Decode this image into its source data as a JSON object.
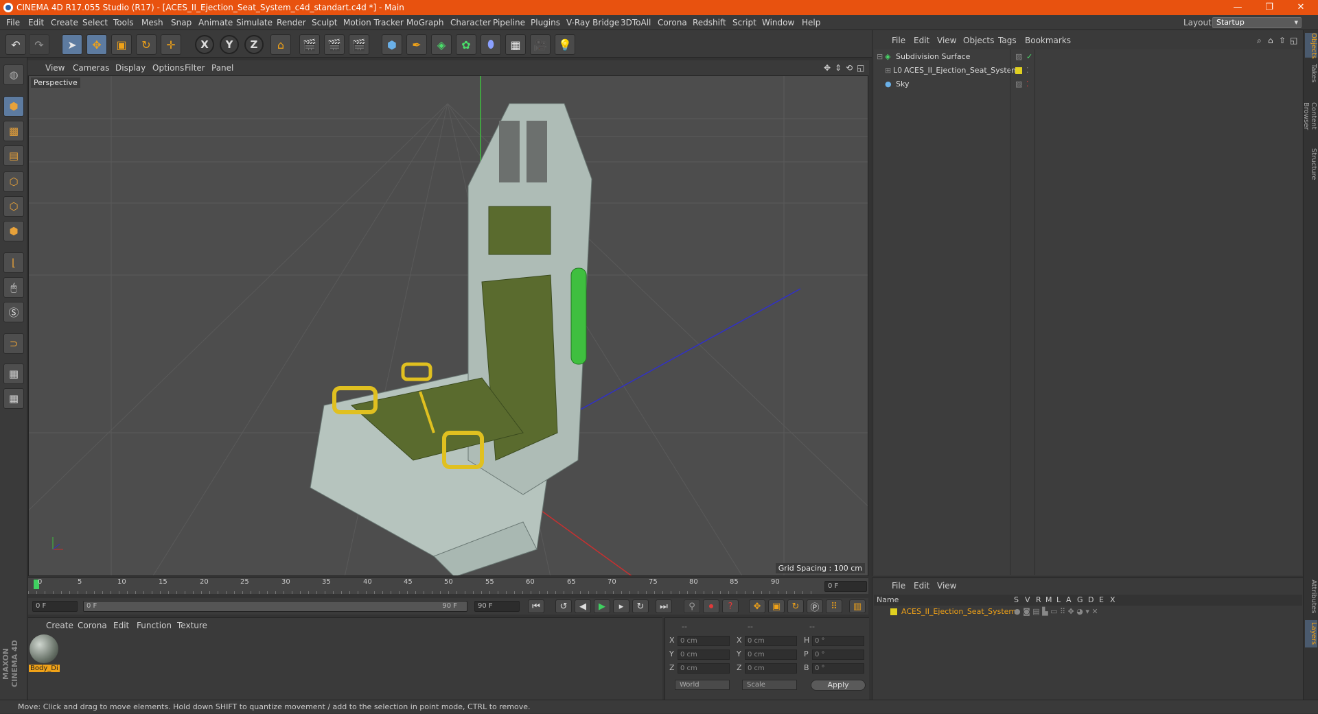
{
  "window": {
    "title": "CINEMA 4D R17.055 Studio (R17) - [ACES_II_Ejection_Seat_System_c4d_standart.c4d *] - Main",
    "minimize": "—",
    "maximize": "❐",
    "close": "✕"
  },
  "menu": [
    "File",
    "Edit",
    "Create",
    "Select",
    "Tools",
    "Mesh",
    "Snap",
    "Animate",
    "Simulate",
    "Render",
    "Sculpt",
    "Motion Tracker",
    "MoGraph",
    "Character",
    "Pipeline",
    "Plugins",
    "V-Ray Bridge",
    "3DToAll",
    "Corona",
    "Redshift",
    "Script",
    "Window",
    "Help"
  ],
  "layout": {
    "label": "Layout:",
    "value": "Startup"
  },
  "toolbar": {
    "x_axis": "X",
    "y_axis": "Y",
    "z_axis": "Z"
  },
  "viewport": {
    "menu": [
      "View",
      "Cameras",
      "Display",
      "Options",
      "Filter",
      "Panel"
    ],
    "label": "Perspective",
    "grid_spacing": "Grid Spacing : 100 cm"
  },
  "timeline": {
    "ticks": [
      "0",
      "5",
      "10",
      "15",
      "20",
      "25",
      "30",
      "35",
      "40",
      "45",
      "50",
      "55",
      "60",
      "65",
      "70",
      "75",
      "80",
      "85",
      "90"
    ],
    "current_frame": "0 F",
    "start_field": "0 F",
    "range_start": "0 F",
    "range_end": "90 F",
    "end_field": "90 F"
  },
  "material_panel": {
    "menu": [
      "Create",
      "Corona",
      "Edit",
      "Function",
      "Texture"
    ],
    "material_name": "Body_Di"
  },
  "coords": {
    "header": [
      "--",
      "--",
      "--"
    ],
    "rows": [
      {
        "l1": "X",
        "v1": "0 cm",
        "l2": "X",
        "v2": "0 cm",
        "l3": "H",
        "v3": "0 °"
      },
      {
        "l1": "Y",
        "v1": "0 cm",
        "l2": "Y",
        "v2": "0 cm",
        "l3": "P",
        "v3": "0 °"
      },
      {
        "l1": "Z",
        "v1": "0 cm",
        "l2": "Z",
        "v2": "0 cm",
        "l3": "B",
        "v3": "0 °"
      }
    ],
    "world": "World",
    "scale": "Scale",
    "apply": "Apply"
  },
  "object_manager": {
    "menu": [
      "File",
      "Edit",
      "View",
      "Objects",
      "Tags",
      "Bookmarks"
    ],
    "objects": [
      {
        "name": "Subdivision Surface",
        "indent": 0
      },
      {
        "name": "ACES_II_Ejection_Seat_System",
        "indent": 1
      },
      {
        "name": "Sky",
        "indent": 0
      }
    ]
  },
  "layer_manager": {
    "menu": [
      "File",
      "Edit",
      "View"
    ],
    "columns": [
      "Name",
      "S",
      "V",
      "R",
      "M",
      "L",
      "A",
      "G",
      "D",
      "E",
      "X"
    ],
    "layer": "ACES_II_Ejection_Seat_System"
  },
  "right_tabs": [
    "Objects",
    "Takes",
    "Content Browser",
    "Structure",
    "Attributes",
    "Layers"
  ],
  "brand": "MAXON CINEMA 4D",
  "status": "Move: Click and drag to move elements. Hold down SHIFT to quantize movement / add to the selection in point mode, CTRL to remove.",
  "colors": {
    "title_bar": "#e8520f",
    "accent": "#f0a218",
    "seat_green": "#5a6b2e",
    "seat_frame": "#b6c4be"
  }
}
